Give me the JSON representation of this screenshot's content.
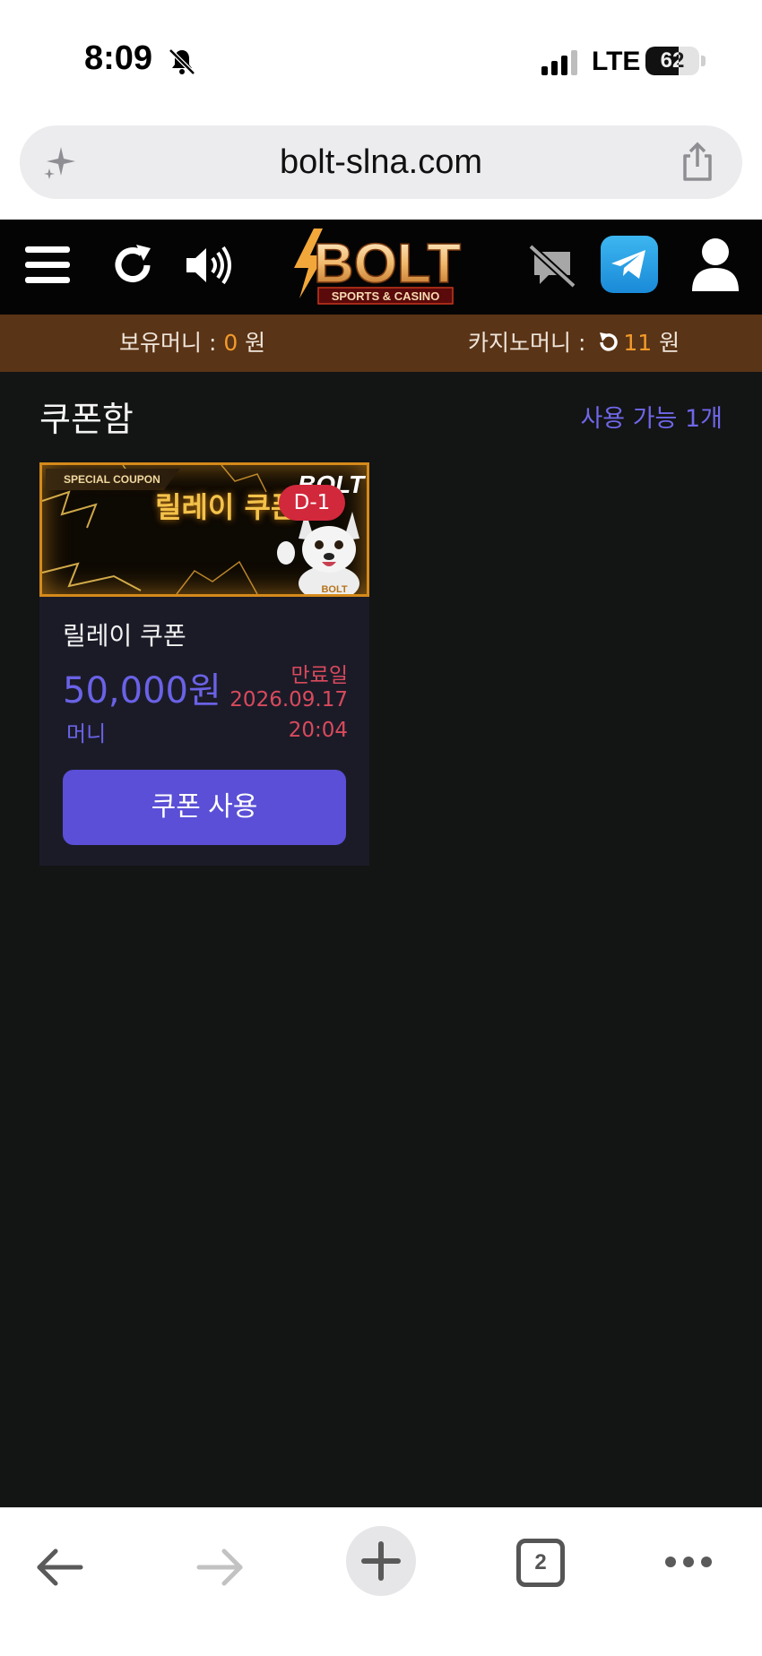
{
  "status_bar": {
    "time": "8:09",
    "network": "LTE",
    "battery_level": "62",
    "battery_fraction": 0.62,
    "icons": [
      "bell-slash-icon",
      "signal-icon",
      "battery-icon"
    ]
  },
  "browser": {
    "url": "bolt-slna.com",
    "tab_count": "2",
    "icons": [
      "sparkle-icon",
      "share-icon",
      "back-icon",
      "forward-icon",
      "plus-icon",
      "more-icon"
    ]
  },
  "header": {
    "logo_text": "BOLT",
    "logo_subtitle": "SPORTS & CASINO",
    "icons": [
      "menu-icon",
      "refresh-icon",
      "sound-icon",
      "chat-off-icon",
      "telegram-icon",
      "user-icon"
    ]
  },
  "balance": {
    "holding_label": "보유머니 : ",
    "holding_value": "0",
    "holding_unit": " 원",
    "casino_label": "카지노머니 : ",
    "casino_value": "11",
    "casino_unit": " 원"
  },
  "page": {
    "title": "쿠폰함",
    "available": "사용 가능 1개"
  },
  "coupon": {
    "banner_tag": "SPECIAL COUPON",
    "banner_title": "릴레이 쿠폰",
    "banner_brand": "BOLT",
    "badge": "D-1",
    "name": "릴레이 쿠폰",
    "amount": "50,000원",
    "unit": "머니",
    "expiry_label": "만료일",
    "expiry_date": "2026.09.17",
    "expiry_time": "20:04",
    "use_button": "쿠폰 사용"
  },
  "colors": {
    "header_bg": "#040404",
    "balance_bg": "#5a3416",
    "accent_orange": "#f39a2b",
    "main_bg": "#131414",
    "accent_purple": "#5a4fd6",
    "expiry_red": "#d94a5c"
  }
}
